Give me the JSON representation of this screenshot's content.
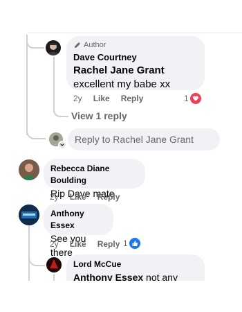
{
  "colors": {
    "heart": "#f33e58",
    "like": "#1877f2",
    "bubble": "#f0f2f5",
    "muted": "#65676b"
  },
  "thread": {
    "comment1": {
      "badge": "Author",
      "author": "Dave Courtney",
      "mention": "Rachel Jane Grant",
      "text": " excellent my babe xx",
      "time": "2y",
      "like": "Like",
      "reply": "Reply",
      "reaction_count": "1",
      "reaction_icon": "heart-icon"
    },
    "view_replies": "View 1 reply",
    "reply_box": {
      "placeholder": "Reply to Rachel Jane Grant"
    },
    "comment2": {
      "author": "Rebecca Diane Boulding",
      "text": "Rip Dave mate",
      "time": "2y",
      "like": "Like",
      "reply": "Reply"
    },
    "comment3": {
      "author": "Anthony Essex",
      "text": "See you there",
      "time": "2y",
      "like": "Like",
      "reply": "Reply",
      "reaction_count": "1",
      "reaction_icon": "thumbs-up-icon"
    },
    "comment4": {
      "author": "Lord McCue",
      "mention": "Anthony Essex",
      "text": " not any more"
    }
  }
}
